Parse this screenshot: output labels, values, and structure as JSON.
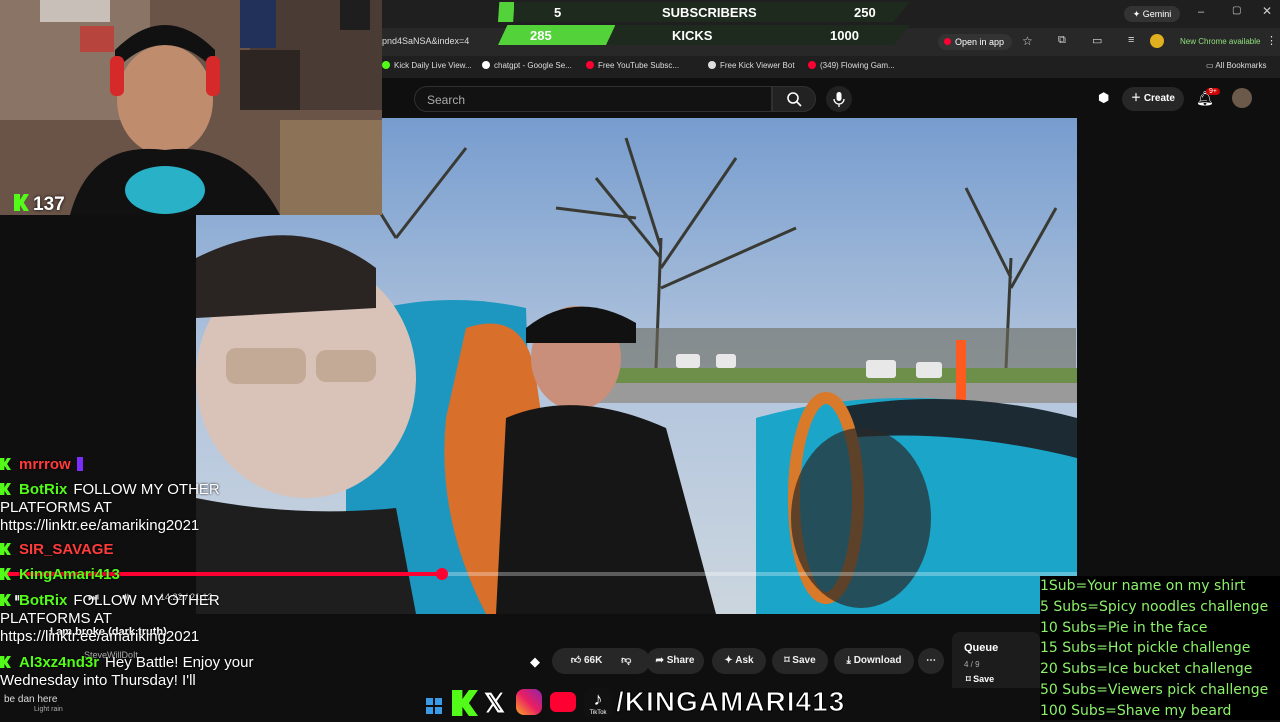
{
  "counter": {
    "subs_current": "5",
    "subs_label": "SUBSCRIBERS",
    "subs_goal": "250",
    "kicks_current": "285",
    "kicks_label": "KICKS",
    "kicks_goal": "1000",
    "kicks_progress": 0.285,
    "subs_progress": 0.02
  },
  "browser": {
    "url_fragment": "pnd4SaNSA&index=4",
    "gemini_label": "Gemini",
    "open_in_app": "Open in app",
    "new_chrome": "New Chrome available",
    "bookmarks": [
      "Kick Daily Live View...",
      "chatgpt - Google Se...",
      "Free YouTube Subsc...",
      "Free Kick Viewer Bot",
      "(349) Flowing Gam..."
    ],
    "all_bookmarks": "All Bookmarks"
  },
  "youtube": {
    "search_placeholder": "Search",
    "create_label": "Create",
    "notif_badge": "9+",
    "time_display": "14:22 / 21:12",
    "progress": 0.41,
    "like_count": "66K",
    "share": "Share",
    "ask": "Ask",
    "save": "Save",
    "download": "Download",
    "queue_title": "Queue",
    "queue_pos": "4 / 9",
    "queue_save": "Save",
    "next_title": "I am broke (dark truth)",
    "channel": "SteveWillDoIt"
  },
  "webcam": {
    "viewer_count": "137"
  },
  "chat": [
    {
      "user": "mrrrow",
      "color": "#ff3b3b",
      "text": ""
    },
    {
      "user": "BotRix",
      "color": "#53fc18",
      "text": "FOLLOW MY OTHER PLATFORMS AT https://linktr.ee/amariking2021"
    },
    {
      "user": "SIR_SAVAGE",
      "color": "#ff3b3b",
      "text": ""
    },
    {
      "user": "KingAmari413",
      "color": "#53fc18",
      "text": ""
    },
    {
      "user": "BotRix",
      "color": "#53fc18",
      "text": "FOLLOW MY OTHER PLATFORMS AT https://linktr.ee/amariking2021"
    },
    {
      "user": "Al3xz4nd3r",
      "color": "#53fc18",
      "text": "Hey Battle! Enjoy your Wednesday into Thursday! I'll"
    }
  ],
  "goals": [
    "1Sub=Your name on my shirt",
    "5 Subs=Spicy noodles challenge",
    "10 Subs=Pie in the face",
    "15 Subs=Hot pickle challenge",
    "20 Subs=Ice bucket challenge",
    "50 Subs=Viewers pick challenge",
    "100 Subs=Shave my beard"
  ],
  "social": {
    "handle": "/KINGAMARI413",
    "tiktok_label": "TikTok"
  },
  "taskbar": {
    "weather": "Light rain",
    "search_text": "be dan here"
  },
  "colors": {
    "kick_green": "#53fc18",
    "yt_red": "#ff0033",
    "goal_text": "#8cf26a"
  }
}
